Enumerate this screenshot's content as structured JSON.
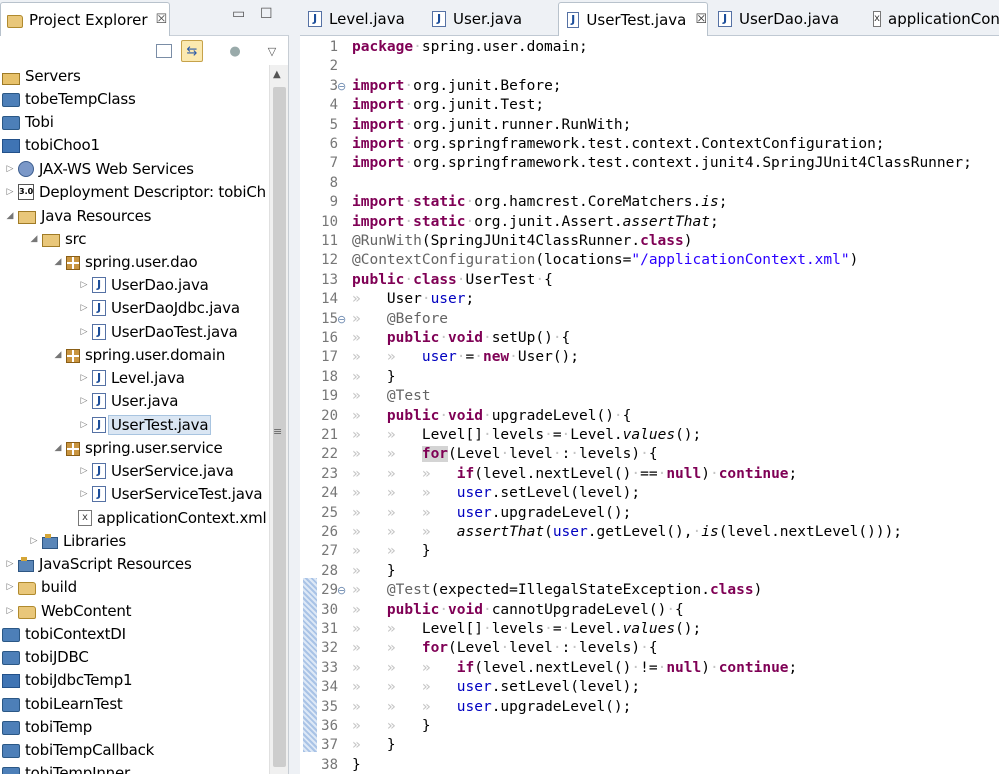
{
  "project_explorer": {
    "tab_label": "Project Explorer",
    "close_glyph": "☒",
    "minimize_glyph": "▭",
    "maximize_glyph": "☐",
    "tree": [
      {
        "label": "Servers",
        "icon": "server-folder-icon"
      },
      {
        "label": "tobeTempClass",
        "icon": "project-icon"
      },
      {
        "label": "Tobi",
        "icon": "project-icon"
      },
      {
        "label": "tobiChoo1",
        "icon": "web-project-icon"
      },
      {
        "label": "JAX-WS Web Services",
        "icon": "webservices-icon"
      },
      {
        "label": "Deployment Descriptor: tobiCh",
        "icon": "deployment-descriptor-icon"
      },
      {
        "label": "Java Resources",
        "icon": "java-resources-icon"
      },
      {
        "label": "src",
        "icon": "source-folder-icon"
      },
      {
        "label": "spring.user.dao",
        "icon": "package-icon"
      },
      {
        "label": "UserDao.java",
        "icon": "java-file-icon"
      },
      {
        "label": "UserDaoJdbc.java",
        "icon": "java-file-icon"
      },
      {
        "label": "UserDaoTest.java",
        "icon": "java-file-icon"
      },
      {
        "label": "spring.user.domain",
        "icon": "package-icon"
      },
      {
        "label": "Level.java",
        "icon": "java-file-icon"
      },
      {
        "label": "User.java",
        "icon": "java-file-icon"
      },
      {
        "label": "UserTest.java",
        "icon": "java-file-icon"
      },
      {
        "label": "spring.user.service",
        "icon": "package-icon"
      },
      {
        "label": "UserService.java",
        "icon": "java-file-icon"
      },
      {
        "label": "UserServiceTest.java",
        "icon": "java-file-icon"
      },
      {
        "label": "applicationContext.xml",
        "icon": "xml-file-icon"
      },
      {
        "label": "Libraries",
        "icon": "libraries-icon"
      },
      {
        "label": "JavaScript Resources",
        "icon": "libraries-icon"
      },
      {
        "label": "build",
        "icon": "folder-icon"
      },
      {
        "label": "WebContent",
        "icon": "folder-icon"
      },
      {
        "label": "tobiContextDI",
        "icon": "project-icon"
      },
      {
        "label": "tobiJDBC",
        "icon": "project-icon"
      },
      {
        "label": "tobiJdbcTemp1",
        "icon": "web-project-icon"
      },
      {
        "label": "tobiLearnTest",
        "icon": "project-icon"
      },
      {
        "label": "tobiTemp",
        "icon": "project-icon"
      },
      {
        "label": "tobiTempCallback",
        "icon": "project-icon"
      },
      {
        "label": "tobiTempInner",
        "icon": "project-icon"
      }
    ]
  },
  "editor": {
    "tabs": [
      {
        "label": "Level.java",
        "icon": "J"
      },
      {
        "label": "User.java",
        "icon": "J"
      },
      {
        "label": "UserTest.java",
        "icon": "J",
        "active": true
      },
      {
        "label": "UserDao.java",
        "icon": "J"
      },
      {
        "label": "applicationCont",
        "icon": "x"
      }
    ],
    "tab_close_glyph": "☒",
    "line_numbers": [
      "1",
      "2",
      "3",
      "4",
      "5",
      "6",
      "7",
      "8",
      "9",
      "10",
      "11",
      "12",
      "13",
      "14",
      "15",
      "16",
      "17",
      "18",
      "19",
      "20",
      "21",
      "22",
      "23",
      "24",
      "25",
      "26",
      "27",
      "28",
      "29",
      "30",
      "31",
      "32",
      "33",
      "34",
      "35",
      "36",
      "37",
      "38"
    ],
    "fold_marker": "⊖",
    "lines": [
      [
        [
          "kw",
          "package"
        ],
        [
          "ws-g",
          "·"
        ],
        [
          "",
          "spring.user.domain;"
        ]
      ],
      [],
      [
        [
          "kw",
          "import"
        ],
        [
          "ws-g",
          "·"
        ],
        [
          "",
          "org.junit.Before;"
        ]
      ],
      [
        [
          "kw",
          "import"
        ],
        [
          "ws-g",
          "·"
        ],
        [
          "",
          "org.junit.Test;"
        ]
      ],
      [
        [
          "kw",
          "import"
        ],
        [
          "ws-g",
          "·"
        ],
        [
          "",
          "org.junit.runner.RunWith;"
        ]
      ],
      [
        [
          "kw",
          "import"
        ],
        [
          "ws-g",
          "·"
        ],
        [
          "",
          "org.springframework.test.context.ContextConfiguration;"
        ]
      ],
      [
        [
          "kw",
          "import"
        ],
        [
          "ws-g",
          "·"
        ],
        [
          "",
          "org.springframework.test.context.junit4.SpringJUnit4ClassRunner;"
        ]
      ],
      [],
      [
        [
          "kw",
          "import"
        ],
        [
          "ws-g",
          "·"
        ],
        [
          "kw",
          "static"
        ],
        [
          "ws-g",
          "·"
        ],
        [
          "",
          "org.hamcrest.CoreMatchers."
        ],
        [
          "it",
          "is"
        ],
        [
          "",
          ";"
        ]
      ],
      [
        [
          "kw",
          "import"
        ],
        [
          "ws-g",
          "·"
        ],
        [
          "kw",
          "static"
        ],
        [
          "ws-g",
          "·"
        ],
        [
          "",
          "org.junit.Assert."
        ],
        [
          "it",
          "assertThat"
        ],
        [
          "",
          ";"
        ]
      ],
      [
        [
          "ann",
          "@RunWith"
        ],
        [
          "",
          "(SpringJUnit4ClassRunner."
        ],
        [
          "kw",
          "class"
        ],
        [
          "",
          ")"
        ]
      ],
      [
        [
          "ann",
          "@ContextConfiguration"
        ],
        [
          "",
          "(locations="
        ],
        [
          "str",
          "\"/applicationContext.xml\""
        ],
        [
          "",
          ")"
        ]
      ],
      [
        [
          "kw",
          "public"
        ],
        [
          "ws-g",
          "·"
        ],
        [
          "kw",
          "class"
        ],
        [
          "ws-g",
          "·"
        ],
        [
          "",
          "UserTest"
        ],
        [
          "ws-g",
          "·"
        ],
        [
          "",
          "{"
        ]
      ],
      [
        [
          "ws-g",
          "»   "
        ],
        [
          "",
          "User"
        ],
        [
          "ws-g",
          "·"
        ],
        [
          "fld",
          "user"
        ],
        [
          "",
          ";"
        ]
      ],
      [
        [
          "ws-g",
          "»   "
        ],
        [
          "ann",
          "@Before"
        ]
      ],
      [
        [
          "ws-g",
          "»   "
        ],
        [
          "kw",
          "public"
        ],
        [
          "ws-g",
          "·"
        ],
        [
          "kw",
          "void"
        ],
        [
          "ws-g",
          "·"
        ],
        [
          "",
          "setUp()"
        ],
        [
          "ws-g",
          "·"
        ],
        [
          "",
          "{"
        ]
      ],
      [
        [
          "ws-g",
          "»   »   "
        ],
        [
          "fld",
          "user"
        ],
        [
          "ws-g",
          "·"
        ],
        [
          "",
          "="
        ],
        [
          "ws-g",
          "·"
        ],
        [
          "kw",
          "new"
        ],
        [
          "ws-g",
          "·"
        ],
        [
          "",
          "User();"
        ]
      ],
      [
        [
          "ws-g",
          "»   "
        ],
        [
          "",
          "}"
        ]
      ],
      [
        [
          "ws-g",
          "»   "
        ],
        [
          "ann",
          "@Test"
        ]
      ],
      [
        [
          "ws-g",
          "»   "
        ],
        [
          "kw",
          "public"
        ],
        [
          "ws-g",
          "·"
        ],
        [
          "kw",
          "void"
        ],
        [
          "ws-g",
          "·"
        ],
        [
          "",
          "upgradeLevel()"
        ],
        [
          "ws-g",
          "·"
        ],
        [
          "",
          "{"
        ]
      ],
      [
        [
          "ws-g",
          "»   »   "
        ],
        [
          "",
          "Level[]"
        ],
        [
          "ws-g",
          "·"
        ],
        [
          "",
          "levels"
        ],
        [
          "ws-g",
          "·"
        ],
        [
          "",
          "="
        ],
        [
          "ws-g",
          "·"
        ],
        [
          "",
          "Level."
        ],
        [
          "it",
          "values"
        ],
        [
          "",
          "();"
        ]
      ],
      [
        [
          "ws-g",
          "»   »   "
        ],
        [
          "kw hl",
          "for"
        ],
        [
          "",
          "(Level"
        ],
        [
          "ws-g",
          "·"
        ],
        [
          "",
          "level"
        ],
        [
          "ws-g",
          "·"
        ],
        [
          "",
          ":"
        ],
        [
          "ws-g",
          "·"
        ],
        [
          "",
          "levels)"
        ],
        [
          "ws-g",
          "·"
        ],
        [
          "",
          "{"
        ]
      ],
      [
        [
          "ws-g",
          "»   »   »   "
        ],
        [
          "kw",
          "if"
        ],
        [
          "",
          "(level.nextLevel()"
        ],
        [
          "ws-g",
          "·"
        ],
        [
          "",
          "=="
        ],
        [
          "ws-g",
          "·"
        ],
        [
          "kw",
          "null"
        ],
        [
          "",
          ")"
        ],
        [
          "ws-g",
          "·"
        ],
        [
          "kw",
          "continue"
        ],
        [
          "",
          ";"
        ]
      ],
      [
        [
          "ws-g",
          "»   »   »   "
        ],
        [
          "fld",
          "user"
        ],
        [
          "",
          ".setLevel(level);"
        ]
      ],
      [
        [
          "ws-g",
          "»   »   »   "
        ],
        [
          "fld",
          "user"
        ],
        [
          "",
          ".upgradeLevel();"
        ]
      ],
      [
        [
          "ws-g",
          "»   »   »   "
        ],
        [
          "it",
          "assertThat"
        ],
        [
          "",
          "("
        ],
        [
          "fld",
          "user"
        ],
        [
          "",
          ".getLevel(),"
        ],
        [
          "ws-g",
          "·"
        ],
        [
          "it",
          "is"
        ],
        [
          "",
          "(level.nextLevel()));"
        ]
      ],
      [
        [
          "ws-g",
          "»   »   "
        ],
        [
          "",
          "}"
        ]
      ],
      [
        [
          "ws-g",
          "»   "
        ],
        [
          "",
          "}"
        ]
      ],
      [
        [
          "ws-g",
          "»   "
        ],
        [
          "ann",
          "@Test"
        ],
        [
          "",
          "(expected=IllegalStateException."
        ],
        [
          "kw",
          "class"
        ],
        [
          "",
          ")"
        ]
      ],
      [
        [
          "ws-g",
          "»   "
        ],
        [
          "kw",
          "public"
        ],
        [
          "ws-g",
          "·"
        ],
        [
          "kw",
          "void"
        ],
        [
          "ws-g",
          "·"
        ],
        [
          "",
          "cannotUpgradeLevel()"
        ],
        [
          "ws-g",
          "·"
        ],
        [
          "",
          "{"
        ]
      ],
      [
        [
          "ws-g",
          "»   »   "
        ],
        [
          "",
          "Level[]"
        ],
        [
          "ws-g",
          "·"
        ],
        [
          "",
          "levels"
        ],
        [
          "ws-g",
          "·"
        ],
        [
          "",
          "="
        ],
        [
          "ws-g",
          "·"
        ],
        [
          "",
          "Level."
        ],
        [
          "it",
          "values"
        ],
        [
          "",
          "();"
        ]
      ],
      [
        [
          "ws-g",
          "»   »   "
        ],
        [
          "kw",
          "for"
        ],
        [
          "",
          "(Level"
        ],
        [
          "ws-g",
          "·"
        ],
        [
          "",
          "level"
        ],
        [
          "ws-g",
          "·"
        ],
        [
          "",
          ":"
        ],
        [
          "ws-g",
          "·"
        ],
        [
          "",
          "levels)"
        ],
        [
          "ws-g",
          "·"
        ],
        [
          "",
          "{"
        ]
      ],
      [
        [
          "ws-g",
          "»   »   »   "
        ],
        [
          "kw",
          "if"
        ],
        [
          "",
          "(level.nextLevel()"
        ],
        [
          "ws-g",
          "·"
        ],
        [
          "",
          "!="
        ],
        [
          "ws-g",
          "·"
        ],
        [
          "kw",
          "null"
        ],
        [
          "",
          ")"
        ],
        [
          "ws-g",
          "·"
        ],
        [
          "kw",
          "continue"
        ],
        [
          "",
          ";"
        ]
      ],
      [
        [
          "ws-g",
          "»   »   »   "
        ],
        [
          "fld",
          "user"
        ],
        [
          "",
          ".setLevel(level);"
        ]
      ],
      [
        [
          "ws-g",
          "»   »   »   "
        ],
        [
          "fld",
          "user"
        ],
        [
          "",
          ".upgradeLevel();"
        ]
      ],
      [
        [
          "ws-g",
          "»   »   "
        ],
        [
          "",
          "}"
        ]
      ],
      [
        [
          "ws-g",
          "»   "
        ],
        [
          "",
          "}"
        ]
      ],
      [
        [
          "",
          "}"
        ]
      ]
    ]
  }
}
